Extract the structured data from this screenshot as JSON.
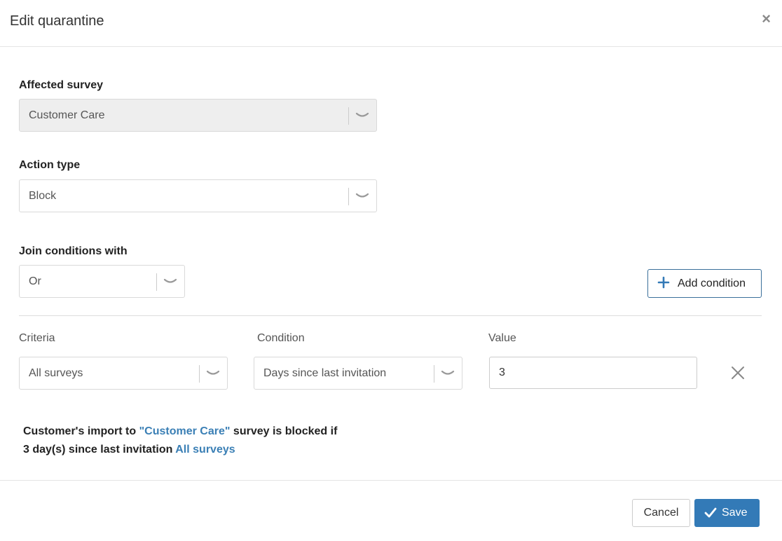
{
  "dialog": {
    "title": "Edit quarantine",
    "close_label": "×"
  },
  "affected_survey": {
    "label": "Affected survey",
    "value": "Customer Care",
    "disabled": true
  },
  "action_type": {
    "label": "Action type",
    "value": "Block"
  },
  "join_conditions": {
    "label": "Join conditions with",
    "value": "Or"
  },
  "add_condition": {
    "label": "Add condition"
  },
  "conditions": {
    "headers": {
      "criteria": "Criteria",
      "condition": "Condition",
      "value": "Value"
    },
    "rows": [
      {
        "criteria": "All surveys",
        "condition": "Days since last invitation",
        "value": "3"
      }
    ]
  },
  "summary": {
    "line1_prefix": "Customer's import to ",
    "line1_survey": "\"Customer Care\"",
    "line1_suffix": " survey is blocked if",
    "line2_prefix": "3 day(s) since last invitation ",
    "line2_criteria": "All surveys"
  },
  "footer": {
    "cancel_label": "Cancel",
    "save_label": "Save"
  },
  "colors": {
    "primary": "#337ab7",
    "highlight_text": "#3a7fb5",
    "disabled_bg": "#eeeeee"
  }
}
